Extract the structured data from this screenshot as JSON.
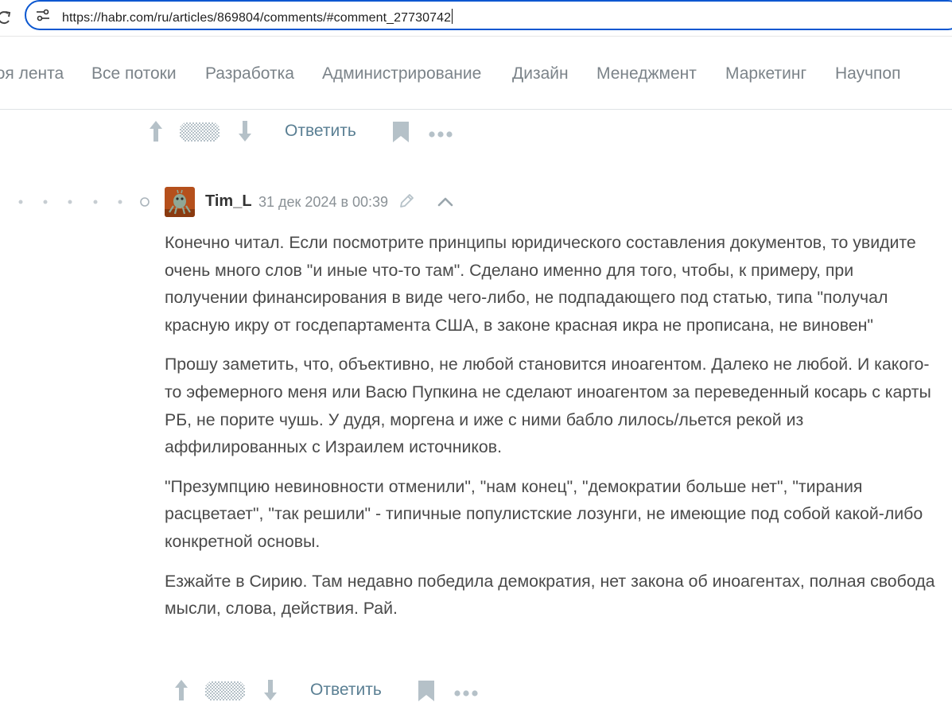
{
  "browser": {
    "url": "https://habr.com/ru/articles/869804/comments/#comment_27730742"
  },
  "nav": {
    "items": [
      "Моя лента",
      "Все потоки",
      "Разработка",
      "Администрирование",
      "Дизайн",
      "Менеджмент",
      "Маркетинг",
      "Научпоп"
    ]
  },
  "top_actions": {
    "reply_label": "Ответить"
  },
  "comment": {
    "author": "Tim_L",
    "date": "31 дек 2024 в 00:39",
    "paragraphs": [
      "Конечно читал. Если посмотрите принципы юридического составления документов, то увидите очень много слов \"и иные что-то там\". Сделано именно для того, чтобы, к примеру, при получении финансирования в виде чего-либо, не подпадающего под статью, типа \"получал красную икру от госдепартамента США, в законе красная икра не прописана, не виновен\"",
      "Прошу заметить, что, объективно, не любой становится иноагентом. Далеко не любой. И какого-то эфемерного меня или Васю Пупкина не сделают иноагентом за переведенный косарь с карты РБ, не порите чушь. У дудя, моргена и иже с ними бабло лилось/льется рекой из аффилированных с Израилем источников.",
      "\"Презумпцию невиновности отменили\", \"нам конец\", \"демократии больше нет\", \"тирания расцветает\", \"так решили\" - типичные популистские лозунги, не имеющие под собой какой-либо конкретной основы.",
      "Езжайте в Сирию. Там недавно победила демократия, нет закона об иноагентах, полная свобода мысли, слова, действия. Рай."
    ],
    "reply_label": "Ответить"
  },
  "colors": {
    "url_focus_border": "#0b57d0",
    "nav_text": "#7b8389",
    "reply_link": "#5a7f93",
    "icon_gray": "#b5c1c8",
    "body_text": "#4a4a4a"
  }
}
